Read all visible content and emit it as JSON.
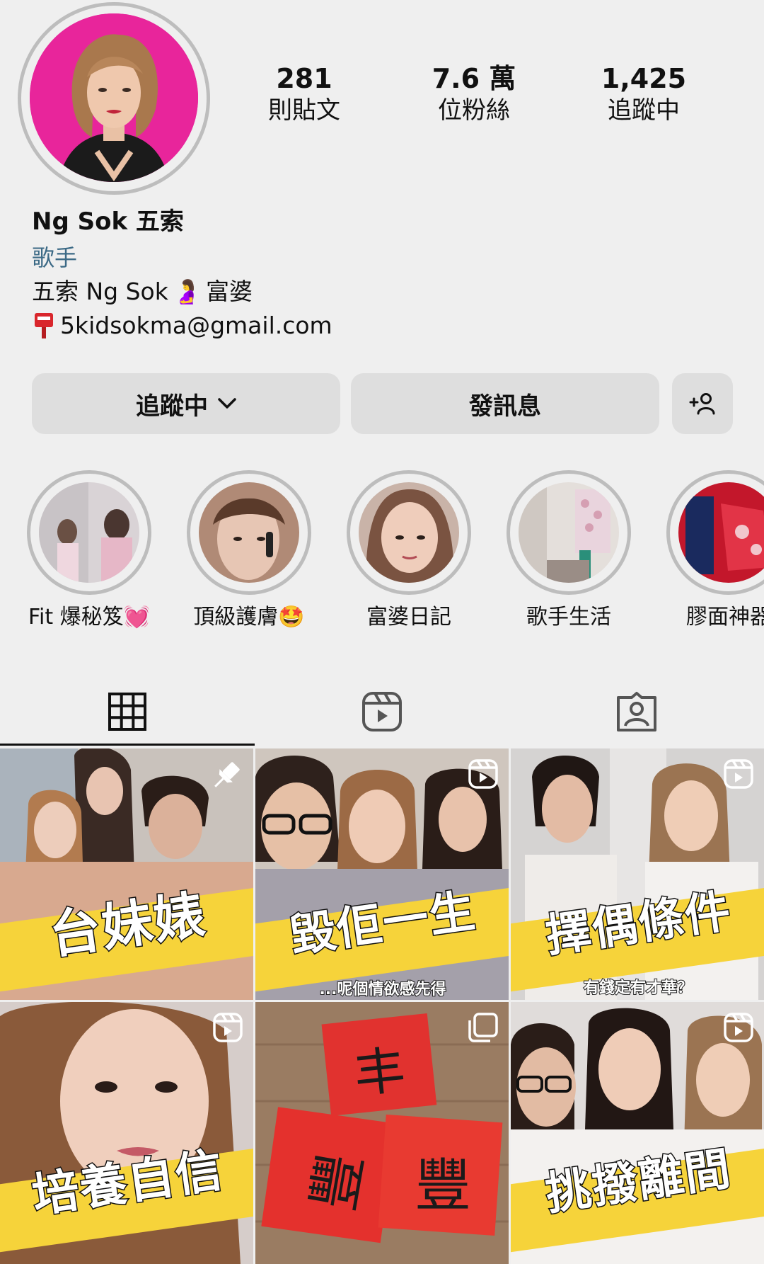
{
  "profile": {
    "name": "Ng Sok 五索",
    "category": "歌手",
    "bio_text": "五索 Ng Sok",
    "bio_tag": "富婆",
    "email": "5kidsokma@gmail.com",
    "emoji_pregnant": "🤰",
    "emoji_postbox": "📮"
  },
  "stats": [
    {
      "value": "281",
      "label": "則貼文"
    },
    {
      "value": "7.6 萬",
      "label": "位粉絲"
    },
    {
      "value": "1,425",
      "label": "追蹤中"
    }
  ],
  "buttons": {
    "following": "追蹤中",
    "message": "發訊息"
  },
  "highlights": [
    {
      "label": "Fit 爆秘笈💓"
    },
    {
      "label": "頂級護膚🤩"
    },
    {
      "label": "富婆日記"
    },
    {
      "label": "歌手生活"
    },
    {
      "label": "膠面神器"
    }
  ],
  "tabs": [
    "grid",
    "reels",
    "tagged"
  ],
  "posts": [
    {
      "caption": "台妹婊",
      "type": "pinned"
    },
    {
      "caption": "毀佢一生",
      "sub": "...呢個情欲感先得",
      "type": "reel"
    },
    {
      "caption": "擇偶條件",
      "sub": "有錢定有才華？",
      "type": "reel"
    },
    {
      "caption": "培養自信",
      "type": "reel"
    },
    {
      "caption": "",
      "type": "carousel",
      "paper_chars": [
        "丰",
        "豐",
        "豐"
      ]
    },
    {
      "caption": "挑撥離間",
      "type": "reel"
    }
  ],
  "colors": {
    "background": "#efefef",
    "button": "#dedede",
    "category": "#3c6a86",
    "banner": "#f6d33a",
    "avatar_bg": "#e8259b"
  }
}
